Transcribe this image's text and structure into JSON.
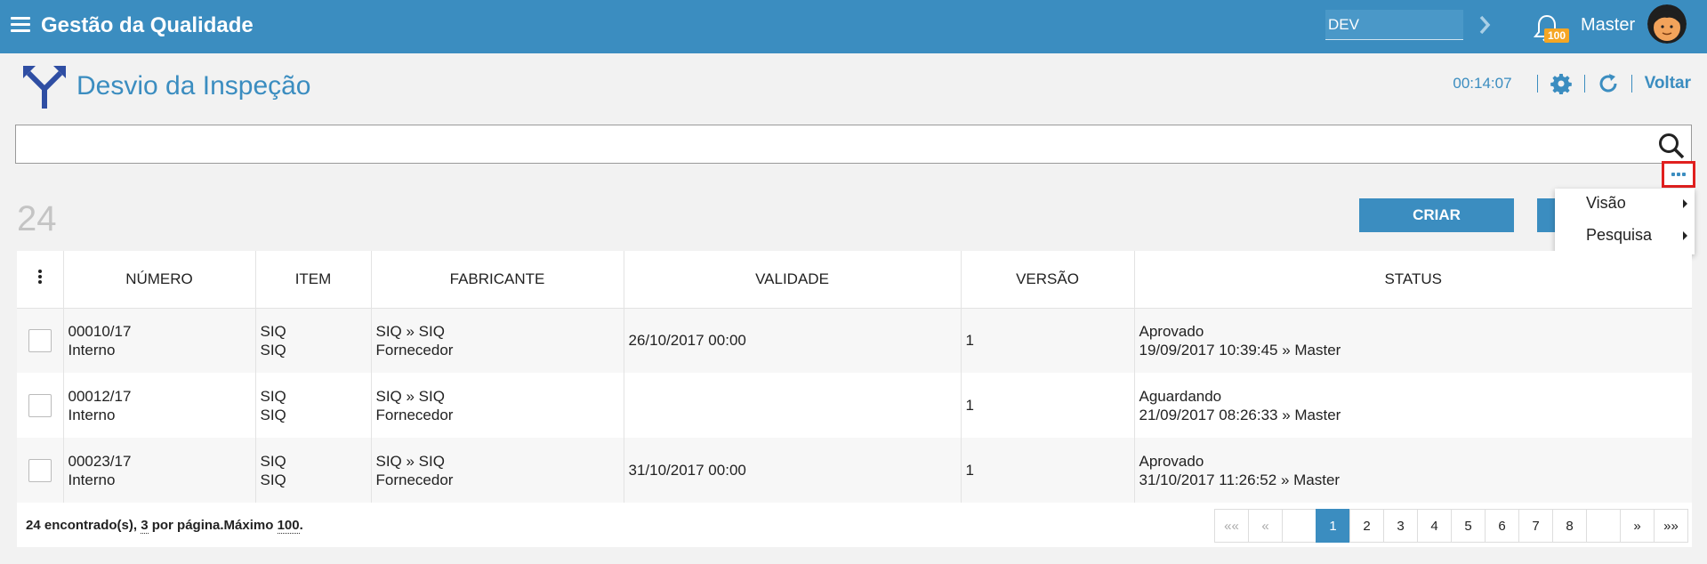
{
  "topbar": {
    "app_title": "Gestão da Qualidade",
    "env_value": "DEV",
    "notification_count": "100",
    "user_name": "Master"
  },
  "page": {
    "title": "Desvio da Inspeção",
    "timer": "00:14:07",
    "back_label": "Voltar"
  },
  "search": {
    "value": "",
    "placeholder": ""
  },
  "record_count": "24",
  "buttons": {
    "create": "CRIAR"
  },
  "menu": {
    "items": [
      {
        "label": "Visão"
      },
      {
        "label": "Pesquisa"
      }
    ]
  },
  "table": {
    "headers": [
      "NÚMERO",
      "ITEM",
      "FABRICANTE",
      "VALIDADE",
      "VERSÃO",
      "STATUS"
    ],
    "rows": [
      {
        "numero": "00010/17",
        "numero_sub": "Interno",
        "item": "SIQ",
        "item_sub": "SIQ",
        "fabricante": "SIQ » SIQ",
        "fabricante_sub": "Fornecedor",
        "validade": "26/10/2017 00:00",
        "versao": "1",
        "status": "Aprovado",
        "status_sub": "19/09/2017 10:39:45 » Master"
      },
      {
        "numero": "00012/17",
        "numero_sub": "Interno",
        "item": "SIQ",
        "item_sub": "SIQ",
        "fabricante": "SIQ » SIQ",
        "fabricante_sub": "Fornecedor",
        "validade": "",
        "versao": "1",
        "status": "Aguardando",
        "status_sub": "21/09/2017 08:26:33 » Master"
      },
      {
        "numero": "00023/17",
        "numero_sub": "Interno",
        "item": "SIQ",
        "item_sub": "SIQ",
        "fabricante": "SIQ » SIQ",
        "fabricante_sub": "Fornecedor",
        "validade": "31/10/2017 00:00",
        "versao": "1",
        "status": "Aprovado",
        "status_sub": "31/10/2017 11:26:52 » Master"
      }
    ]
  },
  "footer": {
    "found": "24 encontrado(s),",
    "per_page_count": "3",
    "per_page_text": "por página.Máximo",
    "max": "100",
    "end": "."
  },
  "pagination": {
    "first": "««",
    "prev": "«",
    "pages": [
      "1",
      "2",
      "3",
      "4",
      "5",
      "6",
      "7",
      "8"
    ],
    "active": "1",
    "next": "»",
    "last": "»»"
  },
  "colors": {
    "primary": "#3b8dc0",
    "badge": "#f5a623",
    "highlight": "#e0201f"
  }
}
